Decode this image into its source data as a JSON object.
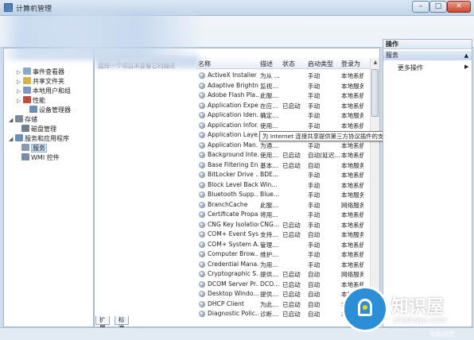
{
  "window": {
    "title": "计算机管理"
  },
  "tree": {
    "items": [
      {
        "label": "事件查看器",
        "icon": "event-viewer-icon",
        "color": "#8aa8c8"
      },
      {
        "label": "共享文件夹",
        "icon": "shared-folder-icon",
        "color": "#d7b24a"
      },
      {
        "label": "本地用户和组",
        "icon": "users-icon",
        "color": "#7a9ac4"
      },
      {
        "label": "性能",
        "icon": "performance-icon",
        "color": "#c44b3e"
      },
      {
        "label": "设备管理器",
        "icon": "device-manager-icon",
        "color": "#6b8fb5"
      },
      {
        "label": "存储",
        "icon": "storage-icon",
        "color": "#7d8a99"
      },
      {
        "label": "磁盘管理",
        "icon": "disk-icon",
        "color": "#6f7f90"
      },
      {
        "label": "服务和应用程序",
        "icon": "services-apps-icon",
        "color": "#6f8fb0"
      },
      {
        "label": "服务",
        "icon": "services-icon",
        "color": "#8a9bb0"
      },
      {
        "label": "WMI 控件",
        "icon": "wmi-icon",
        "color": "#7a8aa3"
      }
    ]
  },
  "center": {
    "description": "选择一个项目来查看它的描述",
    "columns": [
      "名称",
      "描述",
      "状态",
      "启动类型",
      "登录为"
    ],
    "rows": [
      [
        "ActiveX Installer ...",
        "为从 ...",
        "",
        "手动",
        "本地系统"
      ],
      [
        "Adaptive Brightn...",
        "监视...",
        "",
        "手动",
        "本地服务"
      ],
      [
        "Adobe Flash Pla...",
        "此服...",
        "",
        "手动",
        "本地系统"
      ],
      [
        "Application Expe...",
        "在应...",
        "已启动",
        "手动",
        "本地系统"
      ],
      [
        "Application Iden...",
        "确定...",
        "",
        "手动",
        "本地服务"
      ],
      [
        "Application Infor...",
        "使用...",
        "",
        "手动",
        "本地系统"
      ],
      [
        "Application Laye...",
        "为 In...",
        "",
        "手动",
        "本地服务"
      ],
      [
        "Application Man...",
        "为通...",
        "",
        "手动",
        "本地系统"
      ],
      [
        "Background Inte...",
        "使用...",
        "已启动",
        "自动(延迟...",
        "本地系统"
      ],
      [
        "Base Filtering En...",
        "基本...",
        "已启动",
        "自动",
        "本地服务"
      ],
      [
        "BitLocker Drive ...",
        "BDE...",
        "",
        "手动",
        "本地系统"
      ],
      [
        "Block Level Back...",
        "Win...",
        "",
        "手动",
        "本地系统"
      ],
      [
        "Bluetooth Supp...",
        "Blue...",
        "",
        "手动",
        "本地服务"
      ],
      [
        "BranchCache",
        "此服...",
        "",
        "手动",
        "网络服务"
      ],
      [
        "Certificate Propa...",
        "将用...",
        "",
        "手动",
        "本地系统"
      ],
      [
        "CNG Key Isolation",
        "CNG...",
        "已启动",
        "手动",
        "本地系统"
      ],
      [
        "COM+ Event Sys...",
        "支持...",
        "已启动",
        "自动",
        "本地服务"
      ],
      [
        "COM+ System A...",
        "管理...",
        "",
        "手动",
        "本地系统"
      ],
      [
        "Computer Brow...",
        "维护...",
        "",
        "手动",
        "本地系统"
      ],
      [
        "Credential Mana...",
        "为用...",
        "",
        "手动",
        "本地系统"
      ],
      [
        "Cryptographic S...",
        "提供...",
        "已启动",
        "自动",
        "网络服务"
      ],
      [
        "DCOM Server Pr...",
        "DCO...",
        "已启动",
        "自动",
        "本地系统"
      ],
      [
        "Desktop Windo...",
        "提供...",
        "已启动",
        "自动",
        "本地系统"
      ],
      [
        "DHCP Client",
        "为此...",
        "已启动",
        "自动",
        "本地服务"
      ],
      [
        "Diagnostic Polic...",
        "诊断...",
        "已启动",
        "自动",
        "本地服务"
      ]
    ],
    "tooltip": "为 Internet 连接共享提供第三方协议插件的支持"
  },
  "tabs": [
    "扩展",
    "标准"
  ],
  "actions": {
    "header": "操作",
    "section": "服务",
    "item": "更多操作"
  },
  "watermark": {
    "title": "知识屋",
    "url": "zhishiwu.com",
    "sub": "电脑网络"
  },
  "colors": {
    "accent": "#2d8ed8",
    "selection": "#cde3f7"
  }
}
